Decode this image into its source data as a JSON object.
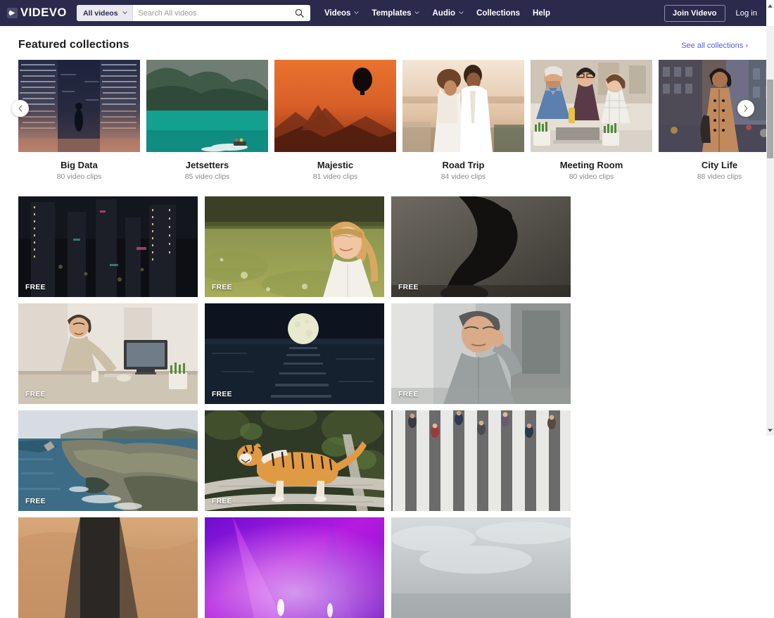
{
  "header": {
    "logo": {
      "text": "VIDEVO",
      "icon": "play-logo-icon"
    },
    "search": {
      "scope_label": "All videos",
      "placeholder": "Search All videos",
      "value": "",
      "icon": "search-icon"
    },
    "nav": [
      {
        "label": "Videos",
        "has_caret": true
      },
      {
        "label": "Templates",
        "has_caret": true
      },
      {
        "label": "Audio",
        "has_caret": true
      },
      {
        "label": "Collections",
        "has_caret": false
      },
      {
        "label": "Help",
        "has_caret": false
      }
    ],
    "join_label": "Join Videvo",
    "login_label": "Log in",
    "background_color": "#2b2a4c"
  },
  "featured": {
    "title": "Featured collections",
    "see_all_label": "See all collections ›",
    "see_all_color": "#5a5ad6",
    "prev_label": "‹",
    "next_label": "›",
    "collections": [
      {
        "name": "Big Data",
        "count": "80 video clips",
        "thumb": "big-data-thumb"
      },
      {
        "name": "Jetsetters",
        "count": "85 video clips",
        "thumb": "jetsetters-thumb"
      },
      {
        "name": "Majestic",
        "count": "81 video clips",
        "thumb": "majestic-thumb"
      },
      {
        "name": "Road Trip",
        "count": "84 video clips",
        "thumb": "road-trip-thumb"
      },
      {
        "name": "Meeting Room",
        "count": "80 video clips",
        "thumb": "meeting-room-thumb"
      },
      {
        "name": "City Life",
        "count": "88 video clips",
        "thumb": "city-life-thumb"
      }
    ]
  },
  "video_grid": {
    "badge_label": "FREE",
    "items": [
      {
        "thumb": "night-city-skyline-thumb",
        "badge": "FREE"
      },
      {
        "thumb": "girl-in-field-thumb",
        "badge": "FREE"
      },
      {
        "thumb": "silhouette-statue-thumb",
        "badge": "FREE"
      },
      {
        "thumb": "man-at-desk-thumb",
        "badge": "FREE"
      },
      {
        "thumb": "moon-over-ocean-thumb",
        "badge": "FREE"
      },
      {
        "thumb": "stressed-man-thumb",
        "badge": "FREE"
      },
      {
        "thumb": "coastal-cliffs-thumb",
        "badge": "FREE"
      },
      {
        "thumb": "tiger-on-logs-thumb",
        "badge": "FREE"
      },
      {
        "thumb": "crosswalk-aerial-thumb",
        "badge": ""
      },
      {
        "thumb": "desert-dunes-thumb",
        "badge": ""
      },
      {
        "thumb": "purple-light-thumb",
        "badge": ""
      },
      {
        "thumb": "grey-sky-thumb",
        "badge": ""
      }
    ]
  },
  "scrollbar": {
    "up_label": "▴",
    "down_label": "▾"
  }
}
